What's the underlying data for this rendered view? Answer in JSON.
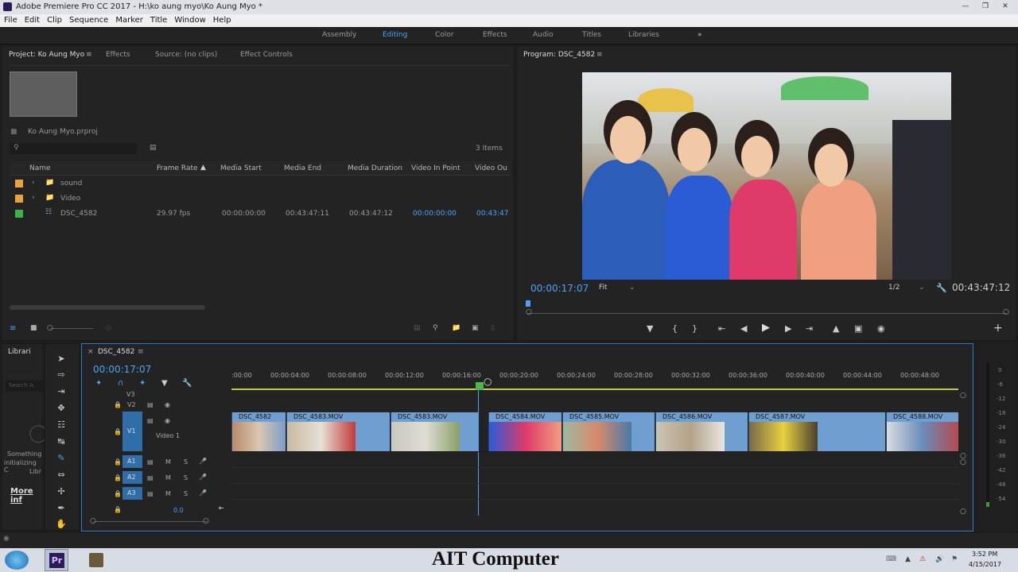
{
  "window": {
    "title": "Adobe Premiere Pro CC 2017 - H:\\ko aung myo\\Ko Aung Myo *"
  },
  "menu": [
    "File",
    "Edit",
    "Clip",
    "Sequence",
    "Marker",
    "Title",
    "Window",
    "Help"
  ],
  "workspaces": [
    "Assembly",
    "Editing",
    "Color",
    "Effects",
    "Audio",
    "Titles",
    "Libraries"
  ],
  "workspace_more": "»",
  "project": {
    "tabs": [
      "Project: Ko Aung Myo",
      "Effects",
      "Source: (no clips)",
      "Effect Controls"
    ],
    "file": "Ko Aung Myo.prproj",
    "items_count": "3 Items",
    "columns": [
      "Name",
      "Frame Rate",
      "Media Start",
      "Media End",
      "Media Duration",
      "Video In Point",
      "Video Ou"
    ],
    "rows": [
      {
        "name": "sound",
        "color": "#e8a33a"
      },
      {
        "name": "Video",
        "color": "#e8a33a"
      },
      {
        "name": "DSC_4582",
        "color": "#3cb34a",
        "frame_rate": "29.97 fps",
        "media_start": "00:00:00:00",
        "media_end": "00:43:47:11",
        "media_duration": "00:43:47:12",
        "in_point": "00:00:00:00",
        "out": "00:43:47"
      }
    ]
  },
  "program": {
    "tab": "Program: DSC_4582",
    "timecode": "00:00:17:07",
    "fit": "Fit",
    "res": "1/2",
    "duration": "00:43:47:12"
  },
  "timeline": {
    "seq": "DSC_4582",
    "timecode": "00:00:17:07",
    "ticks": [
      ":00:00",
      "00:00:04:00",
      "00:00:08:00",
      "00:00:12:00",
      "00:00:16:00",
      "00:00:20:00",
      "00:00:24:00",
      "00:00:28:00",
      "00:00:32:00",
      "00:00:36:00",
      "00:00:40:00",
      "00:00:44:00",
      "00:00:48:00"
    ],
    "tracks_v": [
      "V3",
      "V2",
      "V1"
    ],
    "v1_name": "Video 1",
    "tracks_a": [
      "A1",
      "A2",
      "A3"
    ],
    "m": "M",
    "s": "S",
    "vol": "0.0",
    "clips": [
      "DSC_4582",
      "DSC_4583.MOV",
      "DSC_4583.MOV",
      "DSC_4584.MOV",
      "DSC_4585.MOV",
      "DSC_4586.MOV",
      "DSC_4587.MOV",
      "DSC_4588.MOV"
    ]
  },
  "libraries": {
    "tab": "Librari",
    "search": "Search A",
    "msg1": "Something",
    "msg2": "initializing C",
    "msg3": "Libr",
    "more": "More inf"
  },
  "vu": [
    "0",
    "-6",
    "-12",
    "-18",
    "-24",
    "-30",
    "-36",
    "-42",
    "-48",
    "-54"
  ],
  "taskbar": {
    "caption": "AIT Computer",
    "time": "3:52 PM",
    "date": "4/15/2017",
    "pr": "Pr"
  }
}
